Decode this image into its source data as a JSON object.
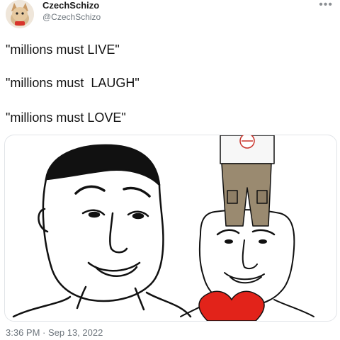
{
  "tweet": {
    "display_name": "CzechSchizo",
    "handle": "@CzechSchizo",
    "more_icon": "more-horizontal-icon",
    "lines": [
      "\"millions must LIVE\"",
      "\"millions must  LAUGH\"",
      "\"millions must LOVE\""
    ],
    "timestamp": "3:36 PM · Sep 13, 2022"
  },
  "media": {
    "panel_left": "wojak-face-smirk",
    "panel_right": "wojak-face-smirk-with-pants-on-head-and-heart",
    "colors": {
      "heart": "#e2231a",
      "pants": "#9a8a70",
      "hair": "#111111",
      "skin": "#ffffff"
    }
  }
}
